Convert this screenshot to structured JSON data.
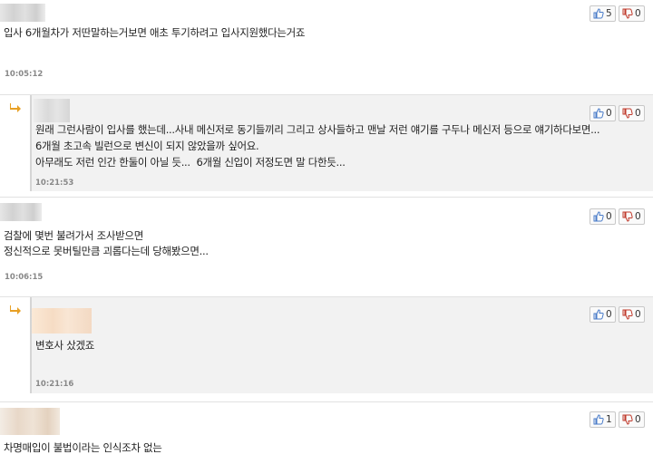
{
  "comments": [
    {
      "id": 1,
      "text": "입사 6개월차가 저딴말하는거보면 애초 투기하려고 입사지원했다는거죠",
      "time": "10:05:12",
      "likes": "5",
      "dislikes": "0"
    },
    {
      "id": 2,
      "reply": true,
      "lines": [
        "원래 그런사람이 입사를 했는데...사내 메신저로 동기들끼리 그리고 상사들하고 맨날 저런 얘기를 구두나 메신저 등으로 얘기하다보면...",
        "6개월 초고속 빌런으로 변신이 되지 않았을까 싶어요.",
        "아무래도 저런 인간 한둘이 아닐 듯...  6개월 신입이 저정도면 말 다한듯..."
      ],
      "time": "10:21:53",
      "likes": "0",
      "dislikes": "0"
    },
    {
      "id": 3,
      "lines": [
        "검찰에 몇번 불려가서 조사받으면",
        "정신적으로 못버틸만큼 괴롭다는데 당해봤으면..."
      ],
      "time": "10:06:15",
      "likes": "0",
      "dislikes": "0"
    },
    {
      "id": 4,
      "reply": true,
      "text": "변호사 샀겠죠",
      "time": "10:21:16",
      "likes": "0",
      "dislikes": "0"
    },
    {
      "id": 5,
      "text": "차명매입이 불법이라는 인식조차 없는",
      "likes": "1",
      "dislikes": "0"
    }
  ],
  "icons": {
    "like": "thumbs-up-icon",
    "dislike": "thumbs-down-icon",
    "reply": "reply-arrow-icon"
  },
  "colors": {
    "like_icon": "#4a7cc9",
    "dislike_icon": "#c0392b",
    "reply_arrow": "#e8a024"
  }
}
